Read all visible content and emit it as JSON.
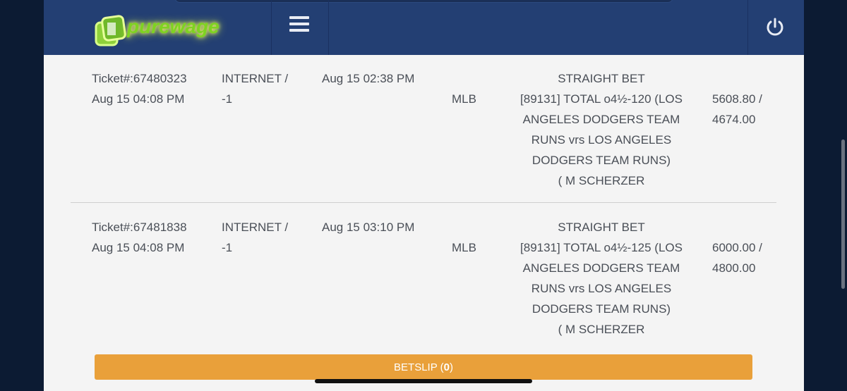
{
  "header": {
    "logo_text": "purewage",
    "colors": {
      "bar": "#233f73",
      "logo_green": "#7ed321",
      "accent_orange": "#e9a03a"
    }
  },
  "tickets": [
    {
      "ticket_no": "Ticket#:67480323",
      "accepted": "Aug 15 04:08 PM",
      "source": "INTERNET /",
      "source_id": "-1",
      "placed": "Aug 15 02:38 PM",
      "sport": "MLB",
      "desc": [
        "STRAIGHT BET",
        "[89131] TOTAL o4½-120 (LOS",
        "ANGELES DODGERS TEAM",
        "RUNS vrs LOS ANGELES",
        "DODGERS TEAM RUNS)",
        "( M SCHERZER"
      ],
      "risk_win": "5608.80 /",
      "win_amount": "4674.00"
    },
    {
      "ticket_no": "Ticket#:67481838",
      "accepted": "Aug 15 04:08 PM",
      "source": "INTERNET /",
      "source_id": "-1",
      "placed": "Aug 15 03:10 PM",
      "sport": "MLB",
      "desc": [
        "STRAIGHT BET",
        "[89131] TOTAL o4½-125 (LOS",
        "ANGELES DODGERS TEAM",
        "RUNS vrs LOS ANGELES",
        "DODGERS TEAM RUNS)",
        "( M SCHERZER"
      ],
      "risk_win": "6000.00 /",
      "win_amount": "4800.00"
    }
  ],
  "betslip": {
    "label": "BETSLIP (",
    "count": "0",
    "close": ")"
  },
  "icons": {
    "menu": "hamburger-icon",
    "power": "power-icon",
    "logo": "purewage-logo"
  }
}
